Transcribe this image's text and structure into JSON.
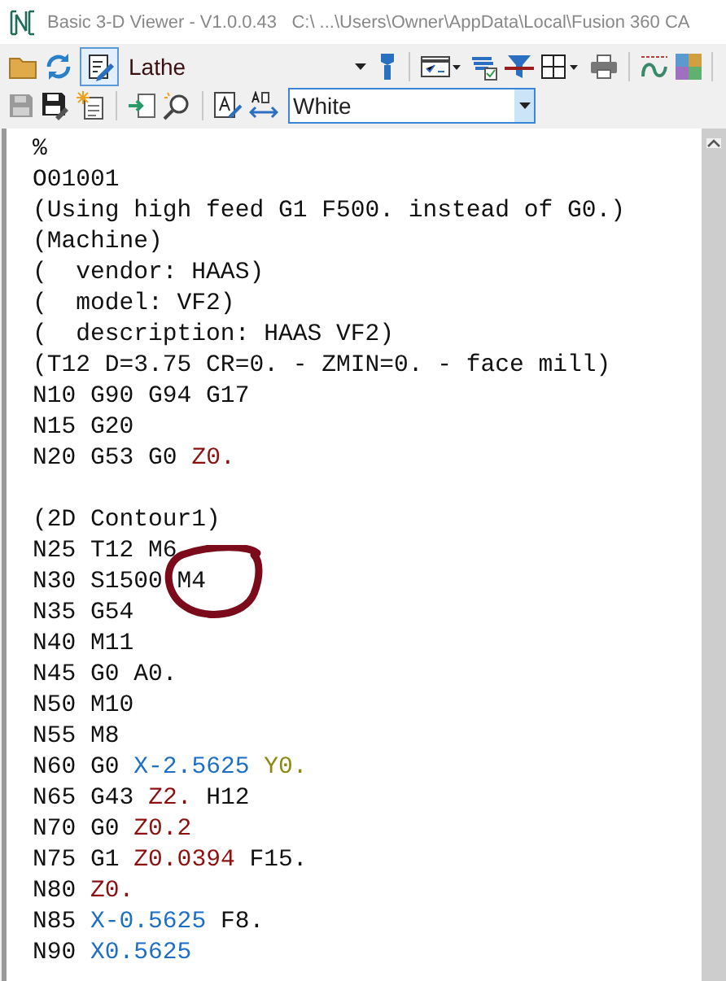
{
  "window": {
    "title": "Basic 3-D Viewer - V1.0.0.43   C:\\ ...\\Users\\Owner\\AppData\\Local\\Fusion 360 CA"
  },
  "toolbar_1": {
    "machine_combo": {
      "value": "Lathe"
    }
  },
  "toolbar_2": {
    "color_combo": {
      "value": "White"
    }
  },
  "editor": {
    "lines": [
      {
        "kind": "code",
        "tokens": [
          {
            "text": "%",
            "kind": "plain"
          }
        ]
      },
      {
        "kind": "code",
        "tokens": [
          {
            "text": "O01001",
            "kind": "plain"
          }
        ]
      },
      {
        "kind": "code",
        "tokens": [
          {
            "text": "(Using high feed G1 F500. instead of G0.)",
            "kind": "plain"
          }
        ]
      },
      {
        "kind": "code",
        "tokens": [
          {
            "text": "(Machine)",
            "kind": "plain"
          }
        ]
      },
      {
        "kind": "code",
        "tokens": [
          {
            "text": "(  vendor: HAAS)",
            "kind": "plain"
          }
        ]
      },
      {
        "kind": "code",
        "tokens": [
          {
            "text": "(  model: VF2)",
            "kind": "plain"
          }
        ]
      },
      {
        "kind": "code",
        "tokens": [
          {
            "text": "(  description: HAAS VF2)",
            "kind": "plain"
          }
        ]
      },
      {
        "kind": "code",
        "tokens": [
          {
            "text": "(T12 D=3.75 CR=0. - ZMIN=0. - face mill)",
            "kind": "plain"
          }
        ]
      },
      {
        "kind": "code",
        "tokens": [
          {
            "text": "N10 G90 G94 G17",
            "kind": "plain"
          }
        ]
      },
      {
        "kind": "code",
        "tokens": [
          {
            "text": "N15 G20",
            "kind": "plain"
          }
        ]
      },
      {
        "kind": "code",
        "tokens": [
          {
            "text": "N20 G53 G0",
            "kind": "plain"
          },
          {
            "text": "Z0.",
            "kind": "z"
          }
        ]
      },
      {
        "kind": "blank"
      },
      {
        "kind": "code",
        "tokens": [
          {
            "text": "(2D Contour1)",
            "kind": "plain"
          }
        ]
      },
      {
        "kind": "code",
        "tokens": [
          {
            "text": "N25 T12 M6",
            "kind": "plain"
          }
        ]
      },
      {
        "kind": "code",
        "tokens": [
          {
            "text": "N30 S1500 M4",
            "kind": "plain"
          }
        ]
      },
      {
        "kind": "code",
        "tokens": [
          {
            "text": "N35 G54",
            "kind": "plain"
          }
        ]
      },
      {
        "kind": "code",
        "tokens": [
          {
            "text": "N40 M11",
            "kind": "plain"
          }
        ]
      },
      {
        "kind": "code",
        "tokens": [
          {
            "text": "N45 G0 A0.",
            "kind": "plain"
          }
        ]
      },
      {
        "kind": "code",
        "tokens": [
          {
            "text": "N50 M10",
            "kind": "plain"
          }
        ]
      },
      {
        "kind": "code",
        "tokens": [
          {
            "text": "N55 M8",
            "kind": "plain"
          }
        ]
      },
      {
        "kind": "code",
        "tokens": [
          {
            "text": "N60 G0",
            "kind": "plain"
          },
          {
            "text": "X-2.5625",
            "kind": "x"
          },
          {
            "text": "Y0.",
            "kind": "y"
          }
        ]
      },
      {
        "kind": "code",
        "tokens": [
          {
            "text": "N65 G43",
            "kind": "plain"
          },
          {
            "text": "Z2.",
            "kind": "z"
          },
          {
            "text": "H12",
            "kind": "plain"
          }
        ]
      },
      {
        "kind": "code",
        "tokens": [
          {
            "text": "N70 G0",
            "kind": "plain"
          },
          {
            "text": "Z0.2",
            "kind": "z"
          }
        ]
      },
      {
        "kind": "code",
        "tokens": [
          {
            "text": "N75 G1",
            "kind": "plain"
          },
          {
            "text": "Z0.0394",
            "kind": "z"
          },
          {
            "text": "F15.",
            "kind": "plain"
          }
        ]
      },
      {
        "kind": "code",
        "tokens": [
          {
            "text": "N80",
            "kind": "plain"
          },
          {
            "text": "Z0.",
            "kind": "z"
          }
        ]
      },
      {
        "kind": "code",
        "tokens": [
          {
            "text": "N85",
            "kind": "plain"
          },
          {
            "text": "X-0.5625",
            "kind": "x"
          },
          {
            "text": "F8.",
            "kind": "plain"
          }
        ]
      },
      {
        "kind": "code",
        "tokens": [
          {
            "text": "N90",
            "kind": "plain"
          },
          {
            "text": "X0.5625",
            "kind": "x"
          }
        ]
      }
    ]
  }
}
